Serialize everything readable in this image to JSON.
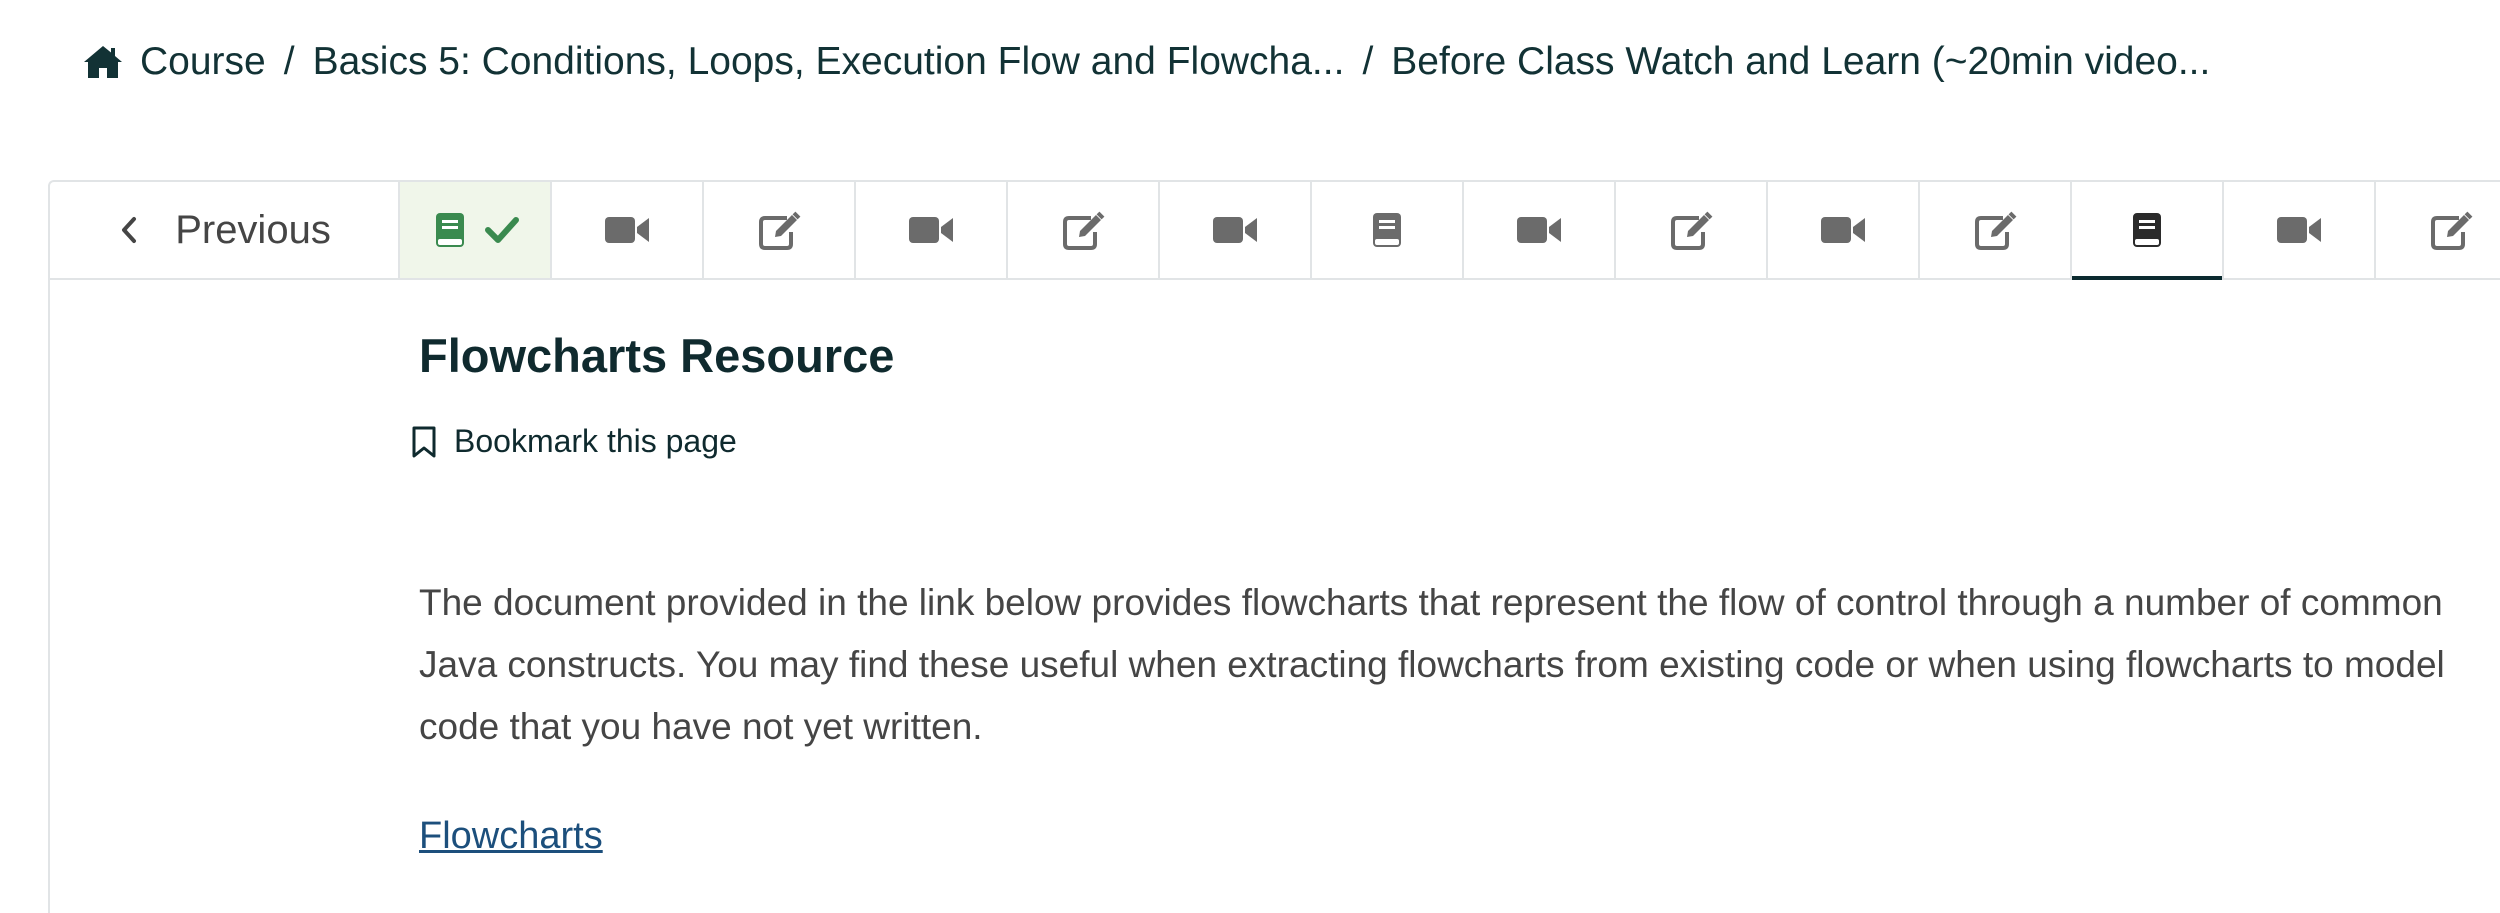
{
  "breadcrumb": {
    "home_icon": "home-icon",
    "items": [
      {
        "label": "Course"
      },
      {
        "label": "Basics 5: Conditions, Loops, Execution Flow and Flowcha..."
      },
      {
        "label": "Before Class Watch and Learn (~20min video..."
      }
    ],
    "separator": "/"
  },
  "unit_nav": {
    "previous_label": "Previous",
    "sequence": [
      {
        "type": "book",
        "state": "complete"
      },
      {
        "type": "video",
        "state": "default"
      },
      {
        "type": "edit",
        "state": "default"
      },
      {
        "type": "video",
        "state": "default"
      },
      {
        "type": "edit",
        "state": "default"
      },
      {
        "type": "video",
        "state": "default"
      },
      {
        "type": "book",
        "state": "default"
      },
      {
        "type": "video",
        "state": "default"
      },
      {
        "type": "edit",
        "state": "default"
      },
      {
        "type": "video",
        "state": "default"
      },
      {
        "type": "edit",
        "state": "default"
      },
      {
        "type": "book",
        "state": "active"
      },
      {
        "type": "video",
        "state": "default"
      },
      {
        "type": "edit",
        "state": "default"
      }
    ],
    "colors": {
      "complete_icon": "#3a8a4f",
      "default_icon": "#6b6b6b",
      "active_icon": "#2b2b2b",
      "active_underline": "#0b2a2f"
    }
  },
  "content": {
    "title": "Flowcharts Resource",
    "bookmark_label": "Bookmark this page",
    "paragraph": "The document provided in the link below provides flowcharts that represent the flow of control through a number of common Java constructs. You may find these useful when extracting flowcharts from existing code or when using flowcharts to model code that you have not yet written.",
    "link_label": "Flowcharts",
    "link_color": "#1c4f7c"
  }
}
